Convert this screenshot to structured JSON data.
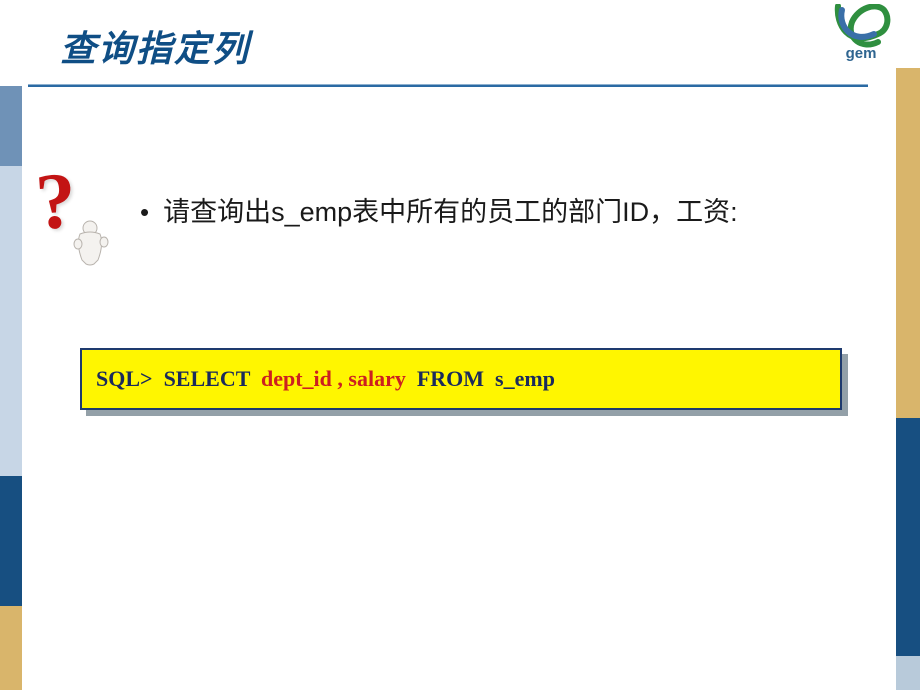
{
  "title": "查询指定列",
  "logo_text": "gem",
  "bullet": {
    "dot": "•",
    "text": "请查询出s_emp表中所有的员工的部门ID，工资:"
  },
  "sql": {
    "prompt": "SQL>  ",
    "select_kw": "SELECT  ",
    "columns": "dept_id , salary",
    "from_clause": "  FROM  s_emp"
  },
  "icons": {
    "question": "?",
    "logo": "gem-logo"
  }
}
